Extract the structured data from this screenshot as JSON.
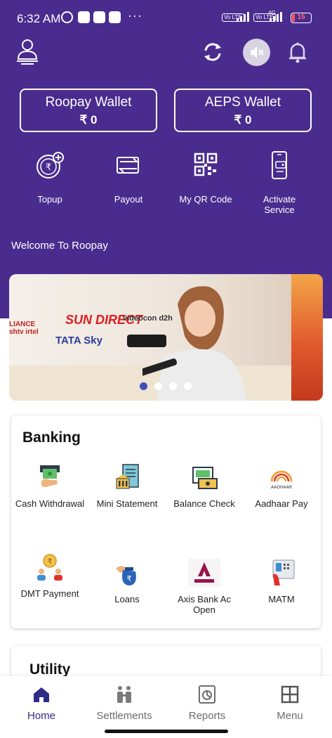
{
  "status_bar": {
    "time": "6:32 AM",
    "battery": "15",
    "net1": "Vo LTE",
    "net2": "Vo LTE",
    "net_type": "4G"
  },
  "header": {
    "icons": [
      "profile-icon",
      "refresh-icon",
      "mute-icon",
      "bell-icon"
    ]
  },
  "wallets": [
    {
      "title": "Roopay Wallet",
      "value": "₹ 0"
    },
    {
      "title": "AEPS Wallet",
      "value": "₹ 0"
    }
  ],
  "quick_actions": [
    "Topup",
    "Payout",
    "My QR Code",
    "Activate Service"
  ],
  "welcome": "Welcome To Roopay",
  "banner": {
    "brand1": "SUN DIRECT",
    "brand2": "TATA Sky",
    "brand3": "videocon d2h",
    "left_text": "LIANCE shtv irtel",
    "active_dot": 0,
    "dot_count": 4
  },
  "banking": {
    "title": "Banking",
    "items": [
      "Cash Withdrawal",
      "Mini Statement",
      "Balance Check",
      "Aadhaar Pay",
      "DMT Payment",
      "Loans",
      "Axis Bank Ac Open",
      "MATM"
    ]
  },
  "utility": {
    "title": "Utility"
  },
  "nav": {
    "items": [
      "Home",
      "Settlements",
      "Reports",
      "Menu"
    ],
    "active": "Home"
  },
  "colors": {
    "primary": "#4a2c8f",
    "nav_active": "#2f2a86"
  }
}
